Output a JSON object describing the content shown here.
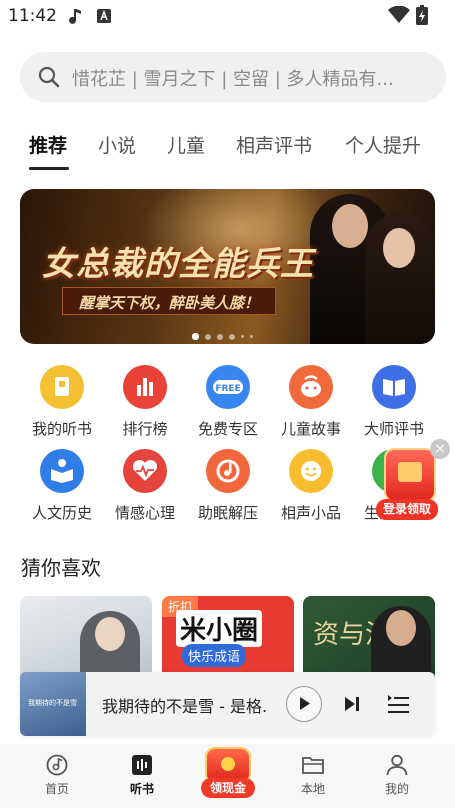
{
  "status_bar": {
    "time": "11:42",
    "icons": [
      "music-note-icon",
      "a-badge-icon",
      "wifi-icon",
      "battery-icon"
    ]
  },
  "search": {
    "placeholder": "惜花芷 | 雪月之下 | 空留 | 多人精品有..."
  },
  "tabs": [
    {
      "label": "推荐",
      "active": true
    },
    {
      "label": "小说",
      "active": false
    },
    {
      "label": "儿童",
      "active": false
    },
    {
      "label": "相声评书",
      "active": false
    },
    {
      "label": "个人提升",
      "active": false
    }
  ],
  "banner": {
    "title": "女总裁的全能兵王",
    "subtitle": "醒掌天下权，醉卧美人膝！",
    "dot_count": 6,
    "active_dot": 0
  },
  "categories": [
    {
      "label": "我的听书",
      "icon": "book-icon",
      "color": "#f5c132"
    },
    {
      "label": "排行榜",
      "icon": "bar-chart-icon",
      "color": "#e94238"
    },
    {
      "label": "免费专区",
      "icon": "free-badge-icon",
      "color": "#3a86f0"
    },
    {
      "label": "儿童故事",
      "icon": "kids-face-icon",
      "color": "#f06a3e"
    },
    {
      "label": "大师评书",
      "icon": "open-book-icon",
      "color": "#3f6fe6"
    },
    {
      "label": "人文历史",
      "icon": "reading-person-icon",
      "color": "#2f7de8"
    },
    {
      "label": "情感心理",
      "icon": "heartbeat-icon",
      "color": "#e7433d"
    },
    {
      "label": "助眠解压",
      "icon": "music-disc-icon",
      "color": "#f2663c"
    },
    {
      "label": "相声小品",
      "icon": "smile-icon",
      "color": "#f7bd2e"
    },
    {
      "label": "生活百科",
      "icon": "leaf-icon",
      "color": "#3db14a"
    }
  ],
  "floating_promo": {
    "label": "登录领取"
  },
  "recommend": {
    "title": "猜你喜欢",
    "cards": [
      {
        "text": ""
      },
      {
        "badge": "折扣",
        "text": "米小圈",
        "subtext": "快乐成语"
      },
      {
        "text": "资与治"
      }
    ]
  },
  "player": {
    "title": "我期待的不是雪 - 是格...",
    "cover_text": "我期待的不是雪"
  },
  "bottom_nav": [
    {
      "label": "首页",
      "icon": "home-disc-icon",
      "active": false
    },
    {
      "label": "听书",
      "icon": "audiobook-icon",
      "active": true
    },
    {
      "label": "领现金",
      "icon": "cash-gift-icon",
      "active": false
    },
    {
      "label": "本地",
      "icon": "folder-icon",
      "active": false
    },
    {
      "label": "我的",
      "icon": "person-icon",
      "active": false
    }
  ]
}
